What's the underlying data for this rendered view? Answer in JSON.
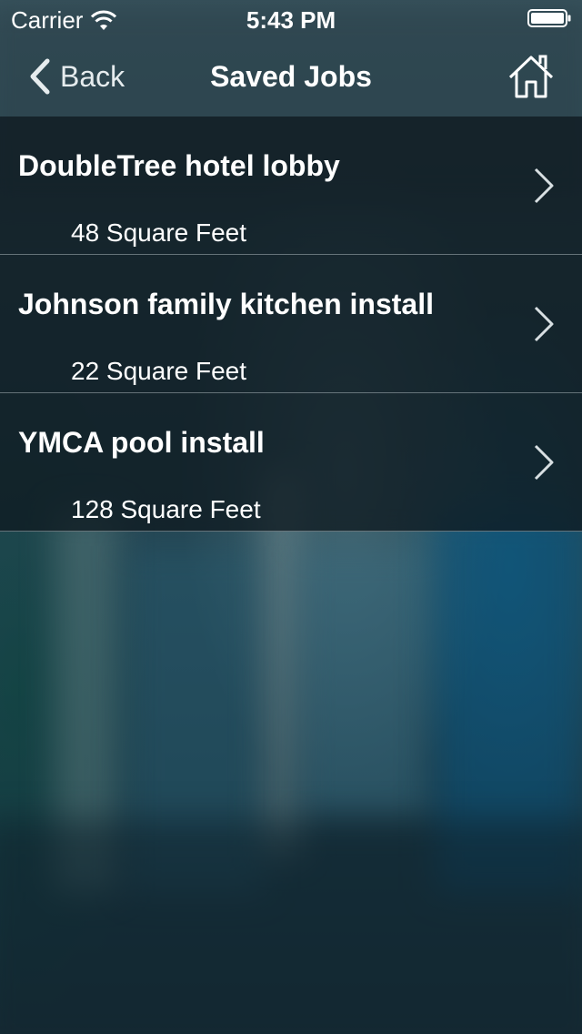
{
  "status_bar": {
    "carrier": "Carrier",
    "time": "5:43 PM"
  },
  "nav": {
    "back_label": "Back",
    "title": "Saved Jobs",
    "home_icon": "home-icon"
  },
  "jobs": [
    {
      "title": "DoubleTree hotel lobby",
      "size": "48 Square Feet"
    },
    {
      "title": "Johnson family kitchen install",
      "size": "22 Square Feet"
    },
    {
      "title": "YMCA pool install",
      "size": "128 Square Feet"
    }
  ],
  "colors": {
    "text": "#ffffff",
    "list_background": "#0e1a20",
    "separator": "#c8d2d7"
  }
}
